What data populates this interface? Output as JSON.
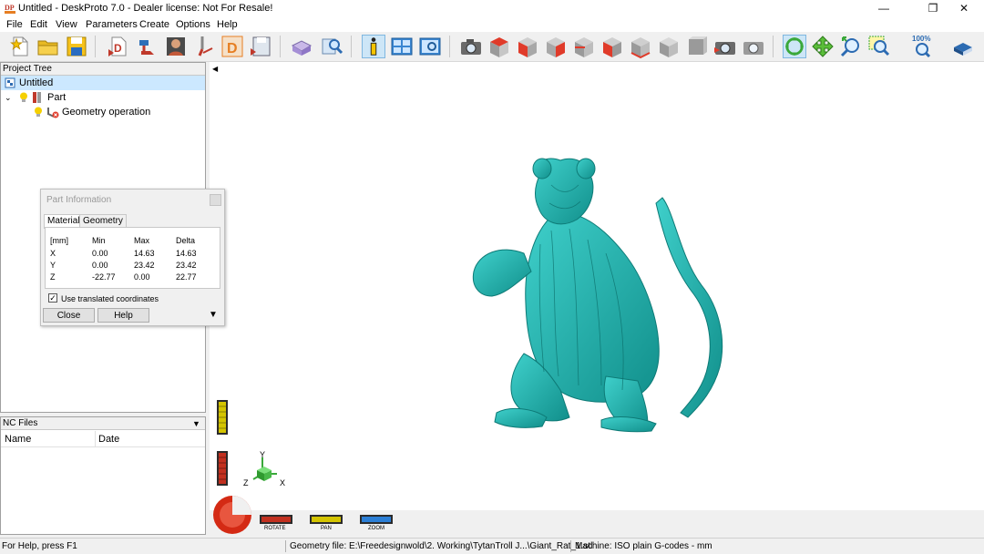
{
  "window": {
    "title": "Untitled - DeskProto 7.0 - Dealer license: Not For Resale!",
    "controls": [
      "minimize",
      "restore",
      "close"
    ]
  },
  "menu": [
    "File",
    "Edit",
    "View",
    "Parameters",
    "Create",
    "Options",
    "Help"
  ],
  "toolbar": {
    "zoom_label": "100%"
  },
  "project_tree": {
    "header": "Project Tree",
    "root": "Untitled",
    "part": "Part",
    "operation": "Geometry operation"
  },
  "nc_files": {
    "header": "NC Files",
    "columns": [
      "Name",
      "Date"
    ]
  },
  "part_information": {
    "title": "Part Information",
    "tabs": [
      "Material",
      "Geometry"
    ],
    "headers": [
      "[mm]",
      "Min",
      "Max",
      "Delta"
    ],
    "rows": [
      {
        "axis": "X",
        "min": "0.00",
        "max": "14.63",
        "delta": "14.63"
      },
      {
        "axis": "Y",
        "min": "0.00",
        "max": "23.42",
        "delta": "23.42"
      },
      {
        "axis": "Z",
        "min": "-22.77",
        "max": "0.00",
        "delta": "22.77"
      }
    ],
    "checkbox_label": "Use translated coordinates",
    "checkbox_checked": true,
    "close_button": "Close",
    "help_button": "Help"
  },
  "viewport": {
    "model_color": "#1fb5b0",
    "axis_labels": {
      "x": "X",
      "y": "Y",
      "z": "Z"
    },
    "mouse_modes": {
      "rotate": "ROTATE",
      "pan": "PAN",
      "zoom": "ZOOM"
    }
  },
  "status": {
    "help": "For Help, press F1",
    "geometry_file": "Geometry file: E:\\Freedesignwold\\2. Working\\TytanTroll J...\\Giant_Rat_1.stl",
    "machine": "Machine: ISO plain G-codes - mm"
  }
}
